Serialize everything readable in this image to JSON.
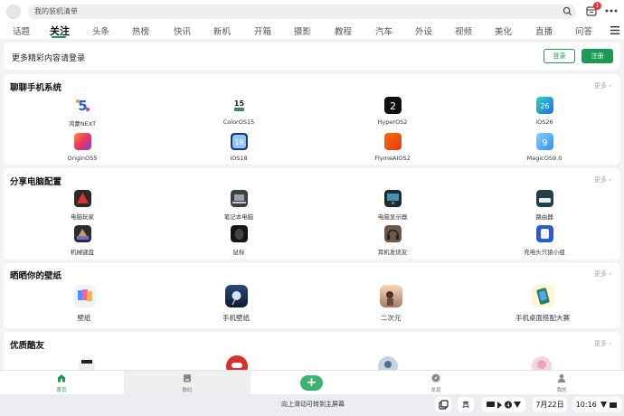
{
  "search": {
    "placeholder": "我的装机清单"
  },
  "notification_count": "1",
  "tabs": [
    "话题",
    "关注",
    "头条",
    "热榜",
    "快讯",
    "新机",
    "开箱",
    "摄影",
    "教程",
    "汽车",
    "外设",
    "视频",
    "美化",
    "直播",
    "问答"
  ],
  "login_bar": {
    "text": "更多精彩内容请登录",
    "login_label": "登录",
    "register_label": "注册"
  },
  "more_label": "更多",
  "sections": {
    "systems": {
      "title": "聊聊手机系统",
      "items": [
        "鸿蒙NEXT",
        "ColorOS15",
        "HyperOS2",
        "iOS26",
        "OriginOS5",
        "iOS18",
        "FlymeAIOS2",
        "MagicOS9.0"
      ]
    },
    "pc": {
      "title": "分享电脑配置",
      "items": [
        "电脑玩家",
        "笔记本电脑",
        "电脑显示器",
        "路由器",
        "机械键盘",
        "鼠标",
        "耳机发烧友",
        "充电头只狼小组"
      ]
    },
    "wallpaper": {
      "title": "晒晒你的壁纸",
      "items": [
        "壁纸",
        "手机壁纸",
        "二次元",
        "手机桌面搭配大赛"
      ]
    },
    "friends": {
      "title": "优质酷友"
    }
  },
  "bottom_nav": {
    "home": "首页",
    "digital": "数码",
    "discover": "发现",
    "me": "我的",
    "plus": "+"
  },
  "system_bar": {
    "swipe_hint": "向上滑动可转到主屏幕",
    "mode": "真",
    "date": "7月22日",
    "time": "10:16"
  },
  "colors": {
    "accent": "#1a9b55"
  }
}
